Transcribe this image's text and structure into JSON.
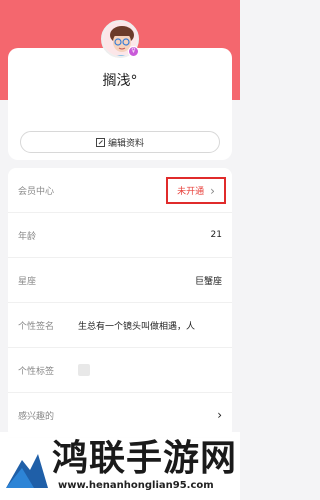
{
  "profile": {
    "nickname": "搁浅°",
    "badge": "♀",
    "edit_label": "编辑资料"
  },
  "rows": [
    {
      "label": "会员中心",
      "status": "未开通"
    },
    {
      "label": "年龄",
      "value": "21"
    },
    {
      "label": "星座",
      "value": "巨蟹座"
    },
    {
      "label": "个性签名",
      "value": "生总有一个镜头叫做相遇，人"
    },
    {
      "label": "个性标签"
    },
    {
      "label": "感兴趣的"
    }
  ],
  "watermark": {
    "title": "鸿联手游网",
    "url": "www.henanhonglian95.com"
  },
  "colors": {
    "header": "#f4676e",
    "accent_red": "#e02b2b",
    "avatar_badge": "#c95ad8"
  }
}
